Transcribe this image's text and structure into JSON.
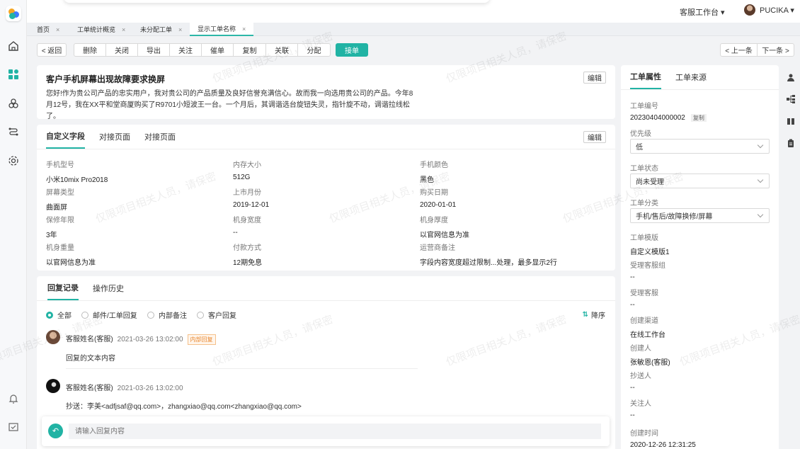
{
  "header": {
    "workspace": "客服工作台 ▾",
    "user_name": "PUCIKA ▾"
  },
  "tabs": [
    {
      "label": "首页"
    },
    {
      "label": "工单统计概览"
    },
    {
      "label": "未分配工单"
    },
    {
      "label": "显示工单名称"
    }
  ],
  "toolbar": {
    "back": "< 返回",
    "actions": [
      "删除",
      "关闭",
      "导出",
      "关注",
      "催单",
      "复制",
      "关联",
      "分配"
    ],
    "accept": "接单",
    "prev": "< 上一条",
    "next": "下一条 >"
  },
  "ticket": {
    "title": "客户手机屏幕出现故障要求换屏",
    "edit": "编辑",
    "description": "您好!作为贵公司产品的忠实用户，我对贵公司的产品质量及良好信誉充满信心。故而我一向选用贵公司的产品。今年8月12号，我在XX平和堂商厦购买了R9701小短波王一台。一个月后，其调谐选台旋钮失灵，指针旋不动，调谐拉线松了。"
  },
  "custom": {
    "tabs": [
      "自定义字段",
      "对接页面",
      "对接页面"
    ],
    "edit": "编辑",
    "fields": [
      {
        "label": "手机型号",
        "value": "小米10mix Pro2018"
      },
      {
        "label": "内存大小",
        "value": "512G"
      },
      {
        "label": "手机颜色",
        "value": "黑色"
      },
      {
        "label": "屏幕类型",
        "value": "曲面屏"
      },
      {
        "label": "上市月份",
        "value": "2019-12-01"
      },
      {
        "label": "购买日期",
        "value": "2020-01-01"
      },
      {
        "label": "保修年限",
        "value": "3年"
      },
      {
        "label": "机身宽度",
        "value": "--"
      },
      {
        "label": "机身厚度",
        "value": "以官网信息为准"
      },
      {
        "label": "机身重量",
        "value": "以官网信息为准"
      },
      {
        "label": "付款方式",
        "value": "12期免息"
      },
      {
        "label": "运营商备注",
        "value": "字段内容宽度超过限制...处理，最多显示2行"
      }
    ]
  },
  "replies": {
    "tabs": [
      "回复记录",
      "操作历史"
    ],
    "filters": [
      "全部",
      "邮件/工单回复",
      "内部备注",
      "客户回复"
    ],
    "sort": "降序",
    "items": [
      {
        "name": "客服姓名(客服)",
        "time": "2021-03-26 13:02:00",
        "badge": "内部回复",
        "text": "回复的文本内容"
      },
      {
        "name": "客服姓名(客服)",
        "time": "2021-03-26 13:02:00",
        "text": "抄送：李美<adfjsaf@qq.com>，zhangxiao@qq.com<zhangxiao@qq.com>"
      }
    ],
    "input_placeholder": "请输入回复内容"
  },
  "side": {
    "tabs": [
      "工单属性",
      "工单来源"
    ],
    "ticket_no_label": "工单编号",
    "ticket_no": "20230404000002",
    "copy": "复制",
    "priority_label": "优先级",
    "priority": "低",
    "status_label": "工单状态",
    "status": "尚未受理",
    "category_label": "工单分类",
    "category": "手机/售后/故障换修/屏幕",
    "fields": [
      {
        "label": "工单模版",
        "value": "自定义模版1"
      },
      {
        "label": "受理客服组",
        "value": "--"
      },
      {
        "label": "受理客服",
        "value": "--"
      },
      {
        "label": "创建渠道",
        "value": "在线工作台"
      },
      {
        "label": "创建人",
        "value": "张敏恩(客服)"
      },
      {
        "label": "抄送人",
        "value": "--"
      },
      {
        "label": "关注人",
        "value": "--"
      },
      {
        "label": "创建时间",
        "value": "2020-12-26 12:31:25"
      }
    ]
  },
  "watermark": "仅限项目相关人员，请保密",
  "colors": {
    "accent": "#21b3a4"
  }
}
